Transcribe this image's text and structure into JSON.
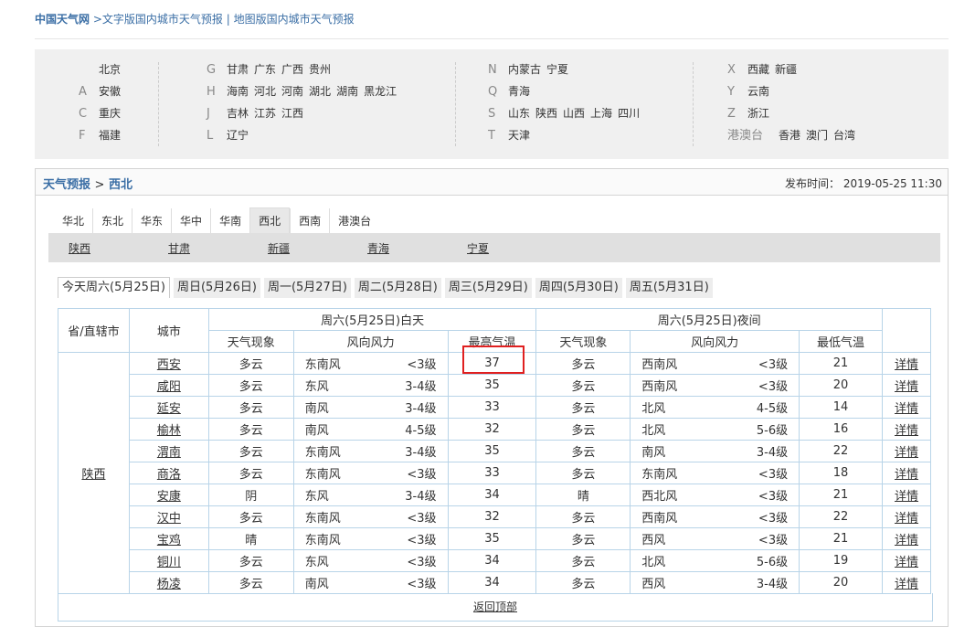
{
  "nav": {
    "site": "中国天气网",
    "link1": ">文字版国内城市天气预报",
    "sep": "|",
    "link2": "地图版国内城市天气预报"
  },
  "regions": {
    "col1": [
      {
        "letter": "",
        "items": [
          "北京"
        ]
      },
      {
        "letter": "A",
        "items": [
          "安徽"
        ]
      },
      {
        "letter": "C",
        "items": [
          "重庆"
        ]
      },
      {
        "letter": "F",
        "items": [
          "福建"
        ]
      }
    ],
    "col2": [
      {
        "letter": "G",
        "items": [
          "甘肃",
          "广东",
          "广西",
          "贵州"
        ]
      },
      {
        "letter": "H",
        "items": [
          "海南",
          "河北",
          "河南",
          "湖北",
          "湖南",
          "黑龙江"
        ]
      },
      {
        "letter": "J",
        "items": [
          "吉林",
          "江苏",
          "江西"
        ]
      },
      {
        "letter": "L",
        "items": [
          "辽宁"
        ]
      }
    ],
    "col3": [
      {
        "letter": "N",
        "items": [
          "内蒙古",
          "宁夏"
        ]
      },
      {
        "letter": "Q",
        "items": [
          "青海"
        ]
      },
      {
        "letter": "S",
        "items": [
          "山东",
          "陕西",
          "山西",
          "上海",
          "四川"
        ]
      },
      {
        "letter": "T",
        "items": [
          "天津"
        ]
      }
    ],
    "col4": [
      {
        "letter": "X",
        "items": [
          "西藏",
          "新疆"
        ]
      },
      {
        "letter": "Y",
        "items": [
          "云南"
        ]
      },
      {
        "letter": "Z",
        "items": [
          "浙江"
        ]
      },
      {
        "letter": "港澳台",
        "items": [
          "香港",
          "澳门",
          "台湾"
        ]
      }
    ]
  },
  "panel": {
    "crumb_home": "天气预报",
    "crumb_sep": ">",
    "crumb_current": "西北",
    "publish_label": "发布时间：",
    "publish_time": "2019-05-25 11:30"
  },
  "area_tabs": [
    "华北",
    "东北",
    "华东",
    "华中",
    "华南",
    "西北",
    "西南",
    "港澳台"
  ],
  "area_active": 5,
  "provinces": [
    "陕西",
    "甘肃",
    "新疆",
    "青海",
    "宁夏"
  ],
  "day_tabs": [
    "今天周六(5月25日)",
    "周日(5月26日)",
    "周一(5月27日)",
    "周二(5月28日)",
    "周三(5月29日)",
    "周四(5月30日)",
    "周五(5月31日)"
  ],
  "table": {
    "h_province": "省/直辖市",
    "h_city": "城市",
    "h_day": "周六(5月25日)白天",
    "h_night": "周六(5月25日)夜间",
    "h_weather": "天气现象",
    "h_wind": "风向风力",
    "h_high": "最高气温",
    "h_low": "最低气温",
    "province": "陕西",
    "detail": "详情",
    "rows": [
      [
        "西安",
        "多云",
        "东南风",
        "<3级",
        "37",
        "多云",
        "西南风",
        "<3级",
        "21"
      ],
      [
        "咸阳",
        "多云",
        "东风",
        "3-4级",
        "35",
        "多云",
        "西南风",
        "<3级",
        "20"
      ],
      [
        "延安",
        "多云",
        "南风",
        "3-4级",
        "33",
        "多云",
        "北风",
        "4-5级",
        "14"
      ],
      [
        "榆林",
        "多云",
        "南风",
        "4-5级",
        "32",
        "多云",
        "北风",
        "5-6级",
        "16"
      ],
      [
        "渭南",
        "多云",
        "东南风",
        "3-4级",
        "35",
        "多云",
        "南风",
        "3-4级",
        "22"
      ],
      [
        "商洛",
        "多云",
        "东南风",
        "<3级",
        "33",
        "多云",
        "东南风",
        "<3级",
        "18"
      ],
      [
        "安康",
        "阴",
        "东风",
        "3-4级",
        "34",
        "晴",
        "西北风",
        "<3级",
        "21"
      ],
      [
        "汉中",
        "多云",
        "东南风",
        "<3级",
        "32",
        "多云",
        "西南风",
        "<3级",
        "22"
      ],
      [
        "宝鸡",
        "晴",
        "东南风",
        "<3级",
        "35",
        "多云",
        "西风",
        "<3级",
        "21"
      ],
      [
        "铜川",
        "多云",
        "东风",
        "<3级",
        "34",
        "多云",
        "北风",
        "5-6级",
        "19"
      ],
      [
        "杨凌",
        "多云",
        "南风",
        "<3级",
        "34",
        "多云",
        "西风",
        "3-4级",
        "20"
      ]
    ]
  },
  "back_top": "返回顶部",
  "colors": {
    "link": "#3a6ea5",
    "border": "#b8d4e8",
    "highlight": "#e02020"
  }
}
